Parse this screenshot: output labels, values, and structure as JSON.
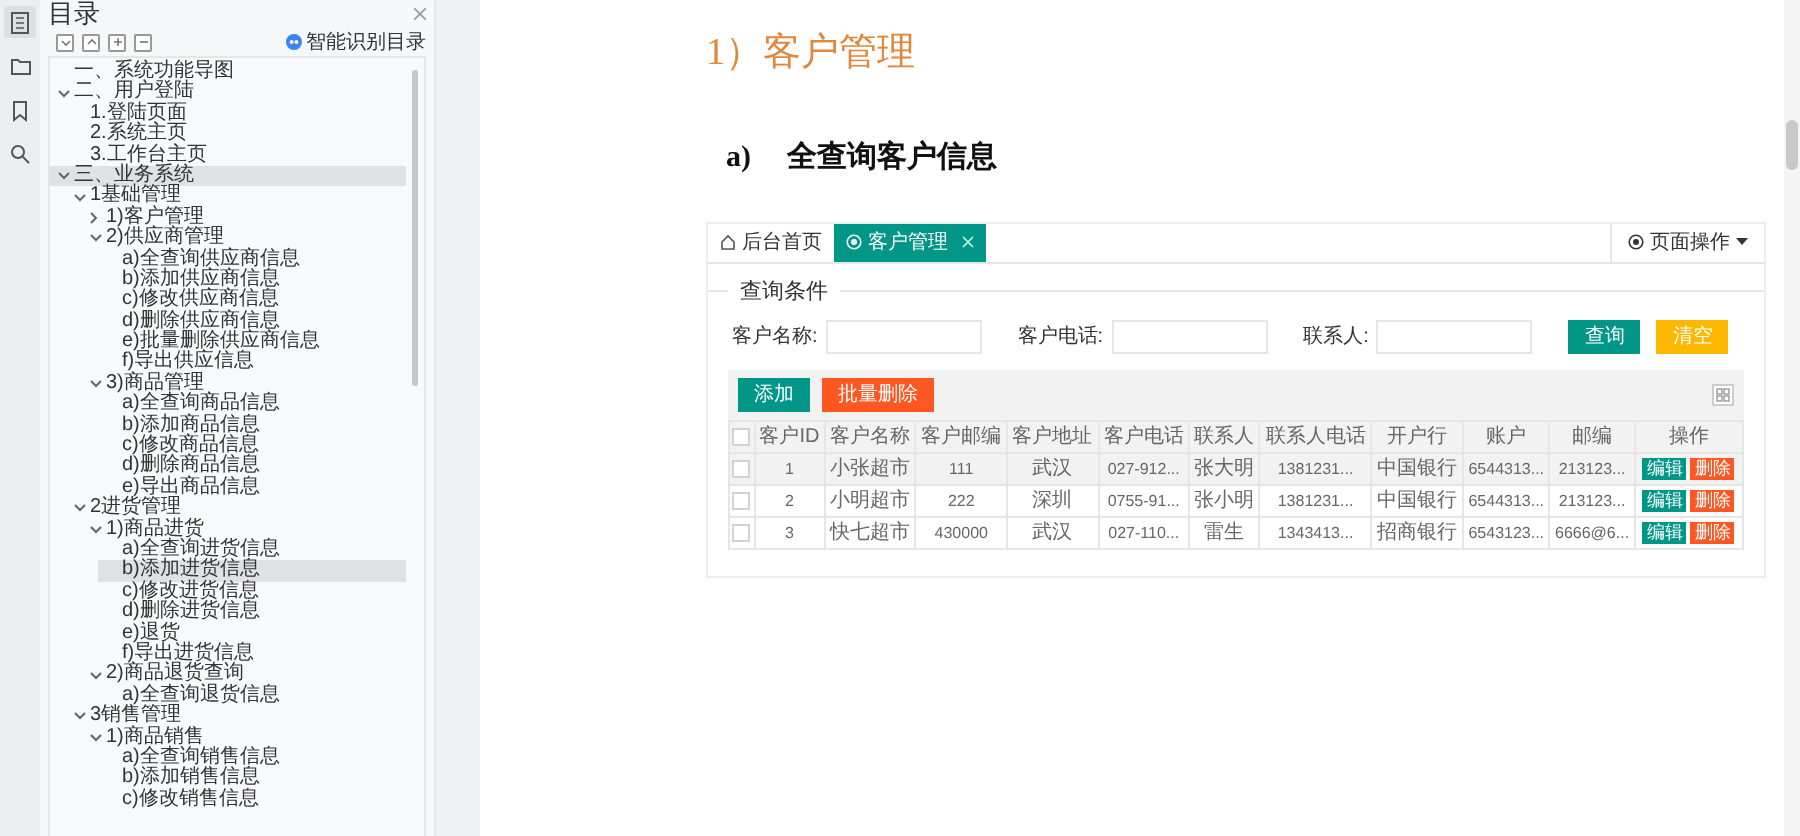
{
  "icon_rail": [
    {
      "selected": true
    },
    {
      "selected": false
    },
    {
      "selected": false
    },
    {
      "selected": false
    }
  ],
  "sidebar": {
    "title": "目录",
    "smart_toc_button": "智能识别目录",
    "tree": [
      {
        "label": "一、系统功能导图",
        "selected": false
      },
      {
        "label": "二、用户登陆",
        "selected": false,
        "expanded": true,
        "children": [
          {
            "label": "1.登陆页面",
            "selected": false
          },
          {
            "label": "2.系统主页",
            "selected": false
          },
          {
            "label": "3.工作台主页",
            "selected": false
          }
        ]
      },
      {
        "label": "三、业务系统",
        "selected": true,
        "expanded": true,
        "children": [
          {
            "label": "1基础管理",
            "selected": false,
            "expanded": true,
            "children": [
              {
                "label": "1)客户管理",
                "selected": false,
                "expanded": false
              },
              {
                "label": "2)供应商管理",
                "selected": false,
                "expanded": true,
                "children": [
                  {
                    "label": "a)全查询供应商信息",
                    "selected": false
                  },
                  {
                    "label": "b)添加供应商信息",
                    "selected": false
                  },
                  {
                    "label": "c)修改供应商信息",
                    "selected": false
                  },
                  {
                    "label": "d)删除供应商信息",
                    "selected": false
                  },
                  {
                    "label": "e)批量删除供应商信息",
                    "selected": false
                  },
                  {
                    "label": "f)导出供应信息",
                    "selected": false
                  }
                ]
              },
              {
                "label": "3)商品管理",
                "selected": false,
                "expanded": true,
                "children": [
                  {
                    "label": "a)全查询商品信息",
                    "selected": false
                  },
                  {
                    "label": "b)添加商品信息",
                    "selected": false
                  },
                  {
                    "label": "c)修改商品信息",
                    "selected": false
                  },
                  {
                    "label": "d)删除商品信息",
                    "selected": false
                  },
                  {
                    "label": "e)导出商品信息",
                    "selected": false
                  }
                ]
              }
            ]
          },
          {
            "label": "2进货管理",
            "selected": false,
            "expanded": true,
            "children": [
              {
                "label": "1)商品进货",
                "selected": false,
                "expanded": true,
                "children": [
                  {
                    "label": "a)全查询进货信息",
                    "selected": false
                  },
                  {
                    "label": "b)添加进货信息",
                    "selected": true
                  },
                  {
                    "label": "c)修改进货信息",
                    "selected": false
                  },
                  {
                    "label": "d)删除进货信息",
                    "selected": false
                  },
                  {
                    "label": "e)退货",
                    "selected": false
                  },
                  {
                    "label": "f)导出进货信息",
                    "selected": false
                  }
                ]
              },
              {
                "label": "2)商品退货查询",
                "selected": false,
                "expanded": true,
                "children": [
                  {
                    "label": "a)全查询退货信息",
                    "selected": false
                  }
                ]
              }
            ]
          },
          {
            "label": "3销售管理",
            "selected": false,
            "expanded": true,
            "children": [
              {
                "label": "1)商品销售",
                "selected": false,
                "expanded": true,
                "children": [
                  {
                    "label": "a)全查询销售信息",
                    "selected": false
                  },
                  {
                    "label": "b)添加销售信息",
                    "selected": false
                  },
                  {
                    "label": "c)修改销售信息",
                    "selected": false
                  }
                ]
              }
            ]
          }
        ]
      }
    ]
  },
  "document": {
    "heading": "1）客户管理",
    "subheading_marker": "a)",
    "subheading": "全查询客户信息",
    "screenshot": {
      "tabs": [
        {
          "label": "后台首页",
          "selected": false
        },
        {
          "label": "客户管理",
          "selected": true
        }
      ],
      "page_menu": "页面操作",
      "fieldset_title": "查询条件",
      "filters": [
        {
          "label": "客户名称:"
        },
        {
          "label": "客户电话:"
        },
        {
          "label": "联系人:"
        }
      ],
      "search_button": "查询",
      "clear_button": "清空",
      "toolbar_buttons": [
        {
          "label": "添加",
          "kind": "primary"
        },
        {
          "label": "批量删除",
          "kind": "danger"
        }
      ],
      "columns": [
        "客户ID",
        "客户名称",
        "客户邮编",
        "客户地址",
        "客户电话",
        "联系人",
        "联系人电话",
        "开户行",
        "账户",
        "邮编",
        "操作"
      ],
      "header_checked": false,
      "rows": [
        {
          "checked": false,
          "highlighted": true,
          "cells": [
            "1",
            "小张超市",
            "111",
            "武汉",
            "027-912...",
            "张大明",
            "1381231...",
            "中国银行",
            "6544313...",
            "213123..."
          ],
          "actions": [
            "编辑",
            "删除"
          ]
        },
        {
          "checked": false,
          "highlighted": false,
          "cells": [
            "2",
            "小明超市",
            "222",
            "深圳",
            "0755-91...",
            "张小明",
            "1381231...",
            "中国银行",
            "6544313...",
            "213123..."
          ],
          "actions": [
            "编辑",
            "删除"
          ]
        },
        {
          "checked": false,
          "highlighted": false,
          "cells": [
            "3",
            "快七超市",
            "430000",
            "武汉",
            "027-110...",
            "雷生",
            "1343413...",
            "招商银行",
            "6543123...",
            "6666@6..."
          ],
          "actions": [
            "编辑",
            "删除"
          ]
        }
      ]
    }
  }
}
